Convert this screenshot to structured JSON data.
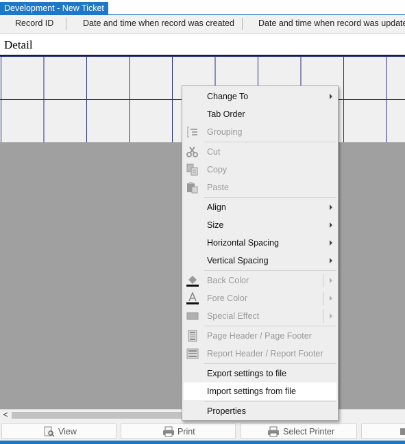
{
  "window": {
    "title": "Development - New Ticket"
  },
  "columns": [
    "Record ID",
    "Date and time when record was created",
    "Date and time when record was updated"
  ],
  "section": {
    "label": "Detail"
  },
  "scrollbar": {
    "left_arrow": "<"
  },
  "toolbar": {
    "view_label": "View",
    "print_label": "Print",
    "select_printer_label": "Select Printer"
  },
  "context_menu": {
    "items": [
      {
        "label": "Change To",
        "enabled": true,
        "submenu": true
      },
      {
        "label": "Tab Order",
        "enabled": true
      },
      {
        "label": "Grouping",
        "enabled": false,
        "icon": "grouping-icon"
      },
      {
        "label": "Cut",
        "enabled": false,
        "icon": "scissors-icon"
      },
      {
        "label": "Copy",
        "enabled": false,
        "icon": "copy-icon"
      },
      {
        "label": "Paste",
        "enabled": false,
        "icon": "paste-icon"
      },
      {
        "label": "Align",
        "enabled": true,
        "submenu": true
      },
      {
        "label": "Size",
        "enabled": true,
        "submenu": true
      },
      {
        "label": "Horizontal Spacing",
        "enabled": true,
        "submenu": true
      },
      {
        "label": "Vertical Spacing",
        "enabled": true,
        "submenu": true
      },
      {
        "label": "Back Color",
        "enabled": false,
        "submenu": true,
        "icon": "paint-bucket-icon"
      },
      {
        "label": "Fore Color",
        "enabled": false,
        "submenu": true,
        "icon": "font-color-icon"
      },
      {
        "label": "Special Effect",
        "enabled": false,
        "submenu": true,
        "icon": "special-effect-icon"
      },
      {
        "label": "Page Header / Page Footer",
        "enabled": false,
        "icon": "page-header-icon"
      },
      {
        "label": "Report Header / Report Footer",
        "enabled": false,
        "icon": "report-header-icon"
      },
      {
        "label": "Export settings to file",
        "enabled": true
      },
      {
        "label": "Import settings from file",
        "enabled": true,
        "highlighted": true
      },
      {
        "label": "Properties",
        "enabled": true
      }
    ]
  },
  "colors": {
    "accent": "#1e78c8",
    "grid_line": "#25307a",
    "menu_bg": "#eeeeee",
    "disabled_text": "#9a9a9a"
  }
}
